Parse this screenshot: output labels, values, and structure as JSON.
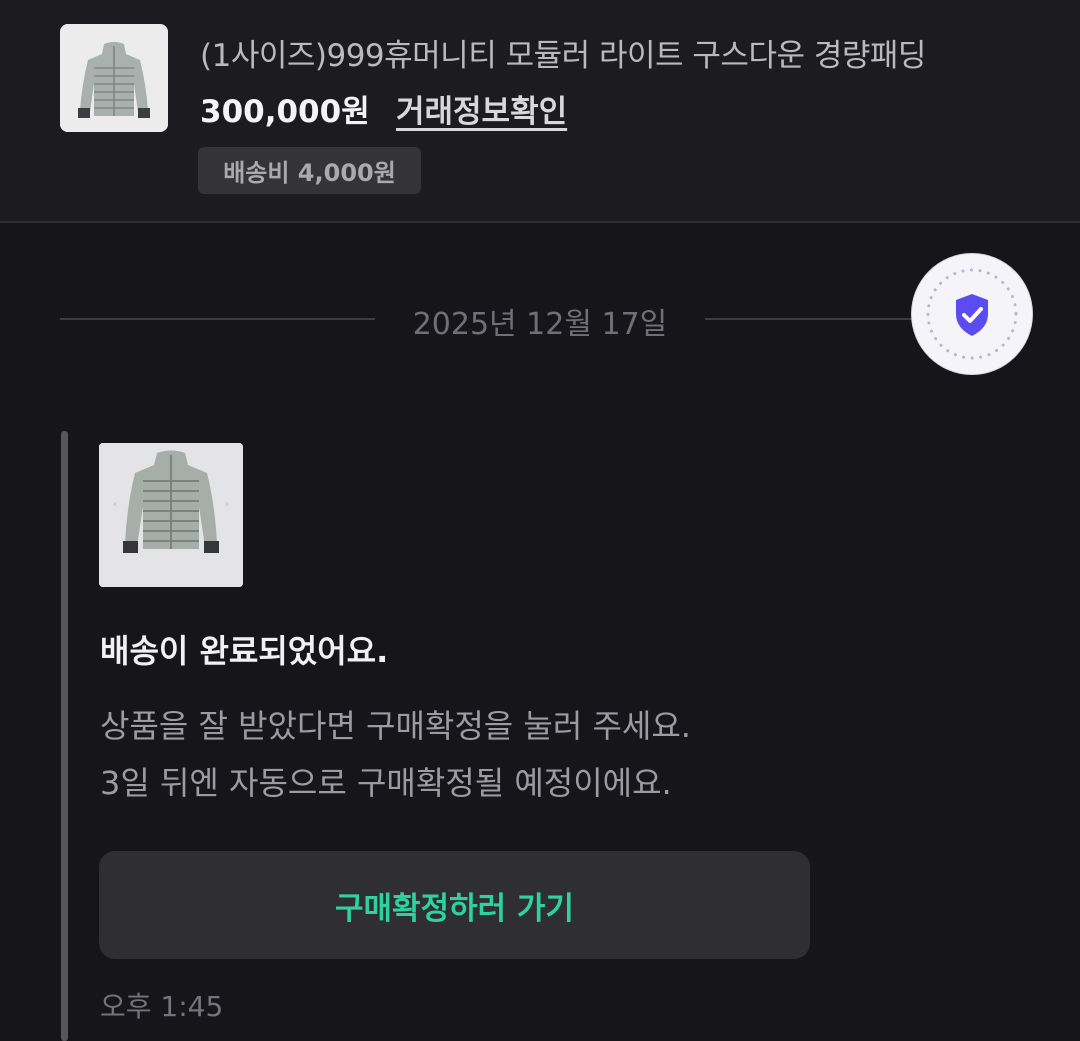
{
  "product": {
    "title": "(1사이즈)999휴머니티 모듈러 라이트 구스다운 경량패딩",
    "price": "300,000원",
    "trade_info_link": "거래정보확인",
    "shipping_fee": "배송비 4,000원",
    "thumbnail_icon": "puffer-jacket-image"
  },
  "chat": {
    "date": "2025년 12월 17일",
    "secure_badge_icon": "shield-check-icon",
    "message": {
      "image_icon": "puffer-jacket-image",
      "title": "배송이 완료되었어요.",
      "body_line1": "상품을 잘 받았다면 구매확정을 눌러 주세요.",
      "body_line2": "3일 뒤엔 자동으로 구매확정될 예정이에요.",
      "button_label": "구매확정하러 가기",
      "time": "오후 1:45"
    }
  },
  "colors": {
    "background": "#16161a",
    "header_background": "#1c1c20",
    "accent_green": "#2fd19c",
    "shield_purple": "#5b4cf0"
  }
}
